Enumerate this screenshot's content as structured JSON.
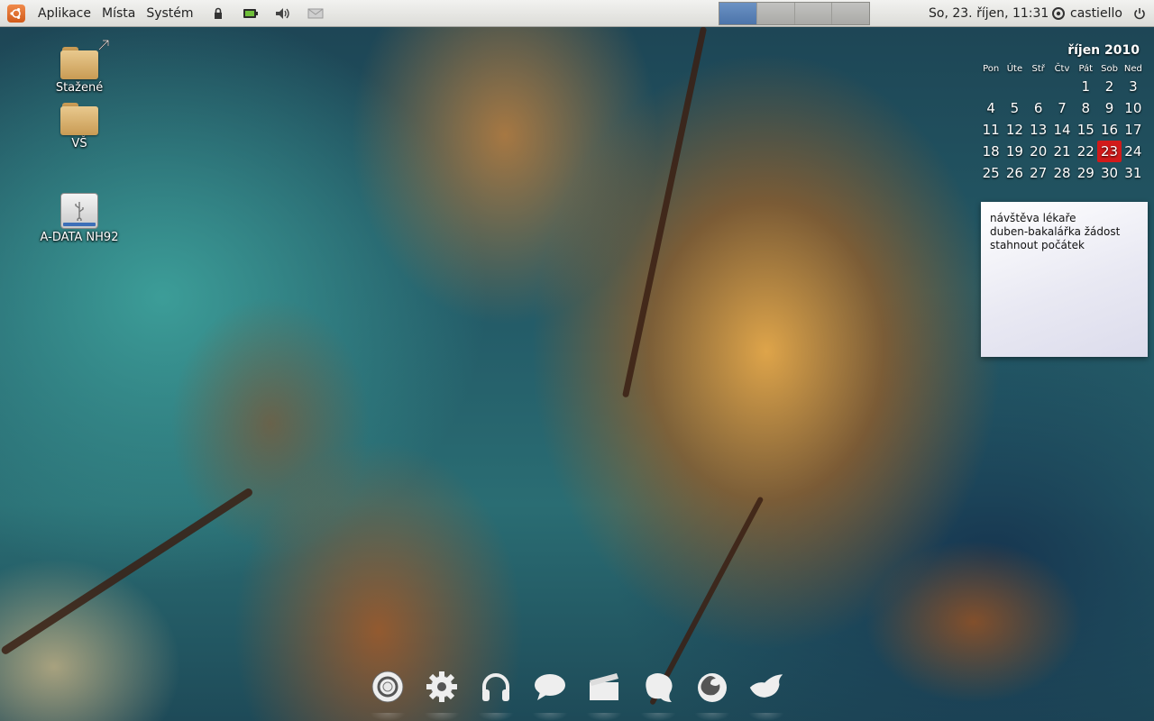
{
  "panel": {
    "menus": [
      "Aplikace",
      "Místa",
      "Systém"
    ],
    "tray_icons": [
      "lock-icon",
      "battery-icon",
      "volume-icon",
      "mail-icon"
    ],
    "workspaces": [
      {
        "active": true
      },
      {
        "active": false
      },
      {
        "active": false
      },
      {
        "active": false
      }
    ],
    "clock": "So, 23. říjen, 11:31",
    "user": "castiello",
    "colors": {
      "panel_bg": "#e6e6e3",
      "workspace_active": "#5a82b8"
    }
  },
  "desktop_icons": [
    {
      "label": "Stažené",
      "icon": "folder-link-icon"
    },
    {
      "label": "VŠ",
      "icon": "folder-icon"
    },
    {
      "label": "A-DATA NH92",
      "icon": "usb-drive-icon"
    }
  ],
  "calendar": {
    "title": "říjen 2010",
    "weekdays": [
      "Pon",
      "Úte",
      "Stř",
      "Čtv",
      "Pát",
      "Sob",
      "Ned"
    ],
    "weeks": [
      [
        "",
        "",
        "",
        "",
        "1",
        "2",
        "3"
      ],
      [
        "4",
        "5",
        "6",
        "7",
        "8",
        "9",
        "10"
      ],
      [
        "11",
        "12",
        "13",
        "14",
        "15",
        "16",
        "17"
      ],
      [
        "18",
        "19",
        "20",
        "21",
        "22",
        "23",
        "24"
      ],
      [
        "25",
        "26",
        "27",
        "28",
        "29",
        "30",
        "31"
      ]
    ],
    "today": "23",
    "today_color": "#d21a1a"
  },
  "sticky_note": {
    "lines": [
      "návštěva lékaře",
      "duben-bakalářka žádost",
      "stahnout počátek"
    ]
  },
  "dock": {
    "items": [
      "chrome-icon",
      "settings-gear-icon",
      "headphones-icon",
      "chat-bubble-icon",
      "clapperboard-icon",
      "pidgin-icon",
      "firefox-icon",
      "thunderbird-icon"
    ]
  }
}
